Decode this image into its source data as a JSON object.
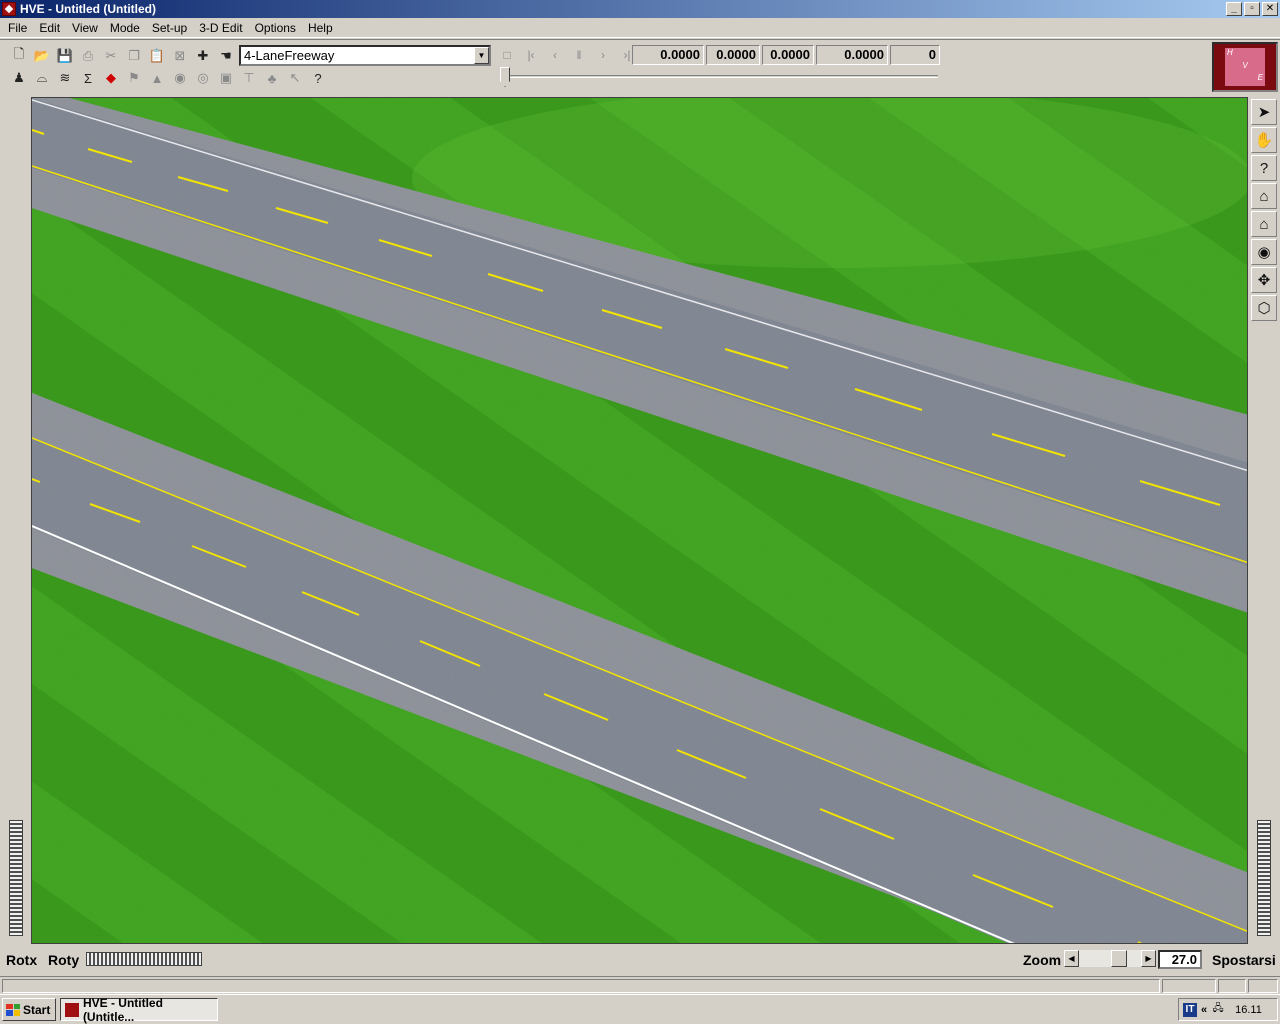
{
  "window": {
    "title": "HVE - Untitled (Untitled)",
    "controls": {
      "minimize": "_",
      "maximize": "▫",
      "close": "✕"
    }
  },
  "menu": [
    "File",
    "Edit",
    "View",
    "Mode",
    "Set-up",
    "3-D Edit",
    "Options",
    "Help"
  ],
  "toolbar": {
    "road_type": "4-LaneFreeway",
    "readouts": [
      "0.0000",
      "0.0000",
      "0.0000",
      "0.0000",
      "0"
    ]
  },
  "logo": {
    "letters": [
      "H",
      "V",
      "E"
    ]
  },
  "bottom": {
    "rotx_label": "Rotx",
    "roty_label": "Roty",
    "zoom_label": "Zoom",
    "zoom_value": "27.0",
    "spostarsi_label": "Spostarsi"
  },
  "taskbar": {
    "start_label": "Start",
    "task_label": "HVE - Untitled (Untitle...",
    "tray_lang": "IT",
    "tray_arrows": "«",
    "clock": "16.11"
  },
  "colors": {
    "grass": "#3c9a1e",
    "road": "#7f8794",
    "shoulder": "#9a9ca2",
    "yellow_line": "#f2e400",
    "white_line": "#ffffff"
  }
}
